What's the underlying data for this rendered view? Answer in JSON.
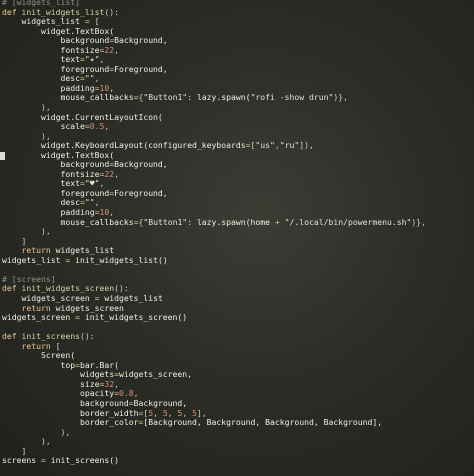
{
  "editor": {
    "cursor_line": 16,
    "lines": [
      [
        {
          "t": "# [widgets_list]",
          "c": "cmt"
        }
      ],
      [
        {
          "t": "def ",
          "c": "kw"
        },
        {
          "t": "init_widgets_list",
          "c": "fn"
        },
        {
          "t": "():",
          "c": "pn"
        }
      ],
      [
        {
          "t": "    widgets_list ",
          "c": "id"
        },
        {
          "t": "= ",
          "c": "op"
        },
        {
          "t": "[",
          "c": "pn"
        }
      ],
      [
        {
          "t": "        widget.TextBox(",
          "c": "id"
        }
      ],
      [
        {
          "t": "            background",
          "c": "id"
        },
        {
          "t": "=",
          "c": "op"
        },
        {
          "t": "Background,",
          "c": "id"
        }
      ],
      [
        {
          "t": "            fontsize",
          "c": "id"
        },
        {
          "t": "=",
          "c": "op"
        },
        {
          "t": "22",
          "c": "num"
        },
        {
          "t": ",",
          "c": "pn"
        }
      ],
      [
        {
          "t": "            text",
          "c": "id"
        },
        {
          "t": "=",
          "c": "op"
        },
        {
          "t": "\"✦\"",
          "c": "str"
        },
        {
          "t": ",",
          "c": "pn"
        }
      ],
      [
        {
          "t": "            foreground",
          "c": "id"
        },
        {
          "t": "=",
          "c": "op"
        },
        {
          "t": "Foreground,",
          "c": "id"
        }
      ],
      [
        {
          "t": "            desc",
          "c": "id"
        },
        {
          "t": "=",
          "c": "op"
        },
        {
          "t": "\"\"",
          "c": "str"
        },
        {
          "t": ",",
          "c": "pn"
        }
      ],
      [
        {
          "t": "            padding",
          "c": "id"
        },
        {
          "t": "=",
          "c": "op"
        },
        {
          "t": "10",
          "c": "num"
        },
        {
          "t": ",",
          "c": "pn"
        }
      ],
      [
        {
          "t": "            mouse_callbacks",
          "c": "id"
        },
        {
          "t": "=",
          "c": "op"
        },
        {
          "t": "{",
          "c": "pn"
        },
        {
          "t": "\"Button1\"",
          "c": "str"
        },
        {
          "t": ": ",
          "c": "pn"
        },
        {
          "t": "lazy",
          "c": "id"
        },
        {
          "t": ".spawn(",
          "c": "id"
        },
        {
          "t": "\"rofi -show drun\"",
          "c": "str"
        },
        {
          "t": ")},",
          "c": "pn"
        }
      ],
      [
        {
          "t": "        ),",
          "c": "pn"
        }
      ],
      [
        {
          "t": "        widget.CurrentLayoutIcon(",
          "c": "id"
        }
      ],
      [
        {
          "t": "            scale",
          "c": "id"
        },
        {
          "t": "=",
          "c": "op"
        },
        {
          "t": "0.5",
          "c": "num"
        },
        {
          "t": ",",
          "c": "pn"
        }
      ],
      [
        {
          "t": "        ),",
          "c": "pn"
        }
      ],
      [
        {
          "t": "        widget.KeyboardLayout(configured_keyboards",
          "c": "id"
        },
        {
          "t": "=",
          "c": "op"
        },
        {
          "t": "[",
          "c": "pn"
        },
        {
          "t": "\"us\"",
          "c": "str"
        },
        {
          "t": ",",
          "c": "pn"
        },
        {
          "t": "\"ru\"",
          "c": "str"
        },
        {
          "t": "]),",
          "c": "pn"
        }
      ],
      [
        {
          "t": "        widget.TextBox(",
          "c": "id"
        }
      ],
      [
        {
          "t": "            background",
          "c": "id"
        },
        {
          "t": "=",
          "c": "op"
        },
        {
          "t": "Background,",
          "c": "id"
        }
      ],
      [
        {
          "t": "            fontsize",
          "c": "id"
        },
        {
          "t": "=",
          "c": "op"
        },
        {
          "t": "22",
          "c": "num"
        },
        {
          "t": ",",
          "c": "pn"
        }
      ],
      [
        {
          "t": "            text",
          "c": "id"
        },
        {
          "t": "=",
          "c": "op"
        },
        {
          "t": "\"♥\"",
          "c": "str"
        },
        {
          "t": ",",
          "c": "pn"
        }
      ],
      [
        {
          "t": "            foreground",
          "c": "id"
        },
        {
          "t": "=",
          "c": "op"
        },
        {
          "t": "Foreground,",
          "c": "id"
        }
      ],
      [
        {
          "t": "            desc",
          "c": "id"
        },
        {
          "t": "=",
          "c": "op"
        },
        {
          "t": "\"\"",
          "c": "str"
        },
        {
          "t": ",",
          "c": "pn"
        }
      ],
      [
        {
          "t": "            padding",
          "c": "id"
        },
        {
          "t": "=",
          "c": "op"
        },
        {
          "t": "10",
          "c": "num"
        },
        {
          "t": ",",
          "c": "pn"
        }
      ],
      [
        {
          "t": "            mouse_callbacks",
          "c": "id"
        },
        {
          "t": "=",
          "c": "op"
        },
        {
          "t": "{",
          "c": "pn"
        },
        {
          "t": "\"Button1\"",
          "c": "str"
        },
        {
          "t": ": ",
          "c": "pn"
        },
        {
          "t": "lazy",
          "c": "id"
        },
        {
          "t": ".spawn(home ",
          "c": "id"
        },
        {
          "t": "+ ",
          "c": "op"
        },
        {
          "t": "\"/.local/bin/powermenu.sh\"",
          "c": "str"
        },
        {
          "t": ")},",
          "c": "pn"
        }
      ],
      [
        {
          "t": "        ),",
          "c": "pn"
        }
      ],
      [
        {
          "t": "    ]",
          "c": "pn"
        }
      ],
      [
        {
          "t": "    return ",
          "c": "kw"
        },
        {
          "t": "widgets_list",
          "c": "id"
        }
      ],
      [
        {
          "t": "widgets_list ",
          "c": "id"
        },
        {
          "t": "= ",
          "c": "op"
        },
        {
          "t": "init_widgets_list()",
          "c": "id"
        }
      ],
      [
        {
          "t": "",
          "c": "id"
        }
      ],
      [
        {
          "t": "# [screens]",
          "c": "cmt"
        }
      ],
      [
        {
          "t": "def ",
          "c": "kw"
        },
        {
          "t": "init_widgets_screen",
          "c": "fn"
        },
        {
          "t": "():",
          "c": "pn"
        }
      ],
      [
        {
          "t": "    widgets_screen ",
          "c": "id"
        },
        {
          "t": "= ",
          "c": "op"
        },
        {
          "t": "widgets_list",
          "c": "id"
        }
      ],
      [
        {
          "t": "    return ",
          "c": "kw"
        },
        {
          "t": "widgets_screen",
          "c": "id"
        }
      ],
      [
        {
          "t": "widgets_screen ",
          "c": "id"
        },
        {
          "t": "= ",
          "c": "op"
        },
        {
          "t": "init_widgets_screen()",
          "c": "id"
        }
      ],
      [
        {
          "t": "",
          "c": "id"
        }
      ],
      [
        {
          "t": "def ",
          "c": "kw"
        },
        {
          "t": "init_screens",
          "c": "fn"
        },
        {
          "t": "():",
          "c": "pn"
        }
      ],
      [
        {
          "t": "    return ",
          "c": "kw"
        },
        {
          "t": "[",
          "c": "pn"
        }
      ],
      [
        {
          "t": "        Screen(",
          "c": "id"
        }
      ],
      [
        {
          "t": "            top",
          "c": "id"
        },
        {
          "t": "=",
          "c": "op"
        },
        {
          "t": "bar.Bar(",
          "c": "id"
        }
      ],
      [
        {
          "t": "                widgets",
          "c": "id"
        },
        {
          "t": "=",
          "c": "op"
        },
        {
          "t": "widgets_screen,",
          "c": "id"
        }
      ],
      [
        {
          "t": "                size",
          "c": "id"
        },
        {
          "t": "=",
          "c": "op"
        },
        {
          "t": "32",
          "c": "num"
        },
        {
          "t": ",",
          "c": "pn"
        }
      ],
      [
        {
          "t": "                opacity",
          "c": "id"
        },
        {
          "t": "=",
          "c": "op"
        },
        {
          "t": "0.8",
          "c": "num"
        },
        {
          "t": ",",
          "c": "pn"
        }
      ],
      [
        {
          "t": "                background",
          "c": "id"
        },
        {
          "t": "=",
          "c": "op"
        },
        {
          "t": "Background,",
          "c": "id"
        }
      ],
      [
        {
          "t": "                border_width",
          "c": "id"
        },
        {
          "t": "=",
          "c": "op"
        },
        {
          "t": "[",
          "c": "pn"
        },
        {
          "t": "5",
          "c": "num"
        },
        {
          "t": ", ",
          "c": "pn"
        },
        {
          "t": "5",
          "c": "num"
        },
        {
          "t": ", ",
          "c": "pn"
        },
        {
          "t": "5",
          "c": "num"
        },
        {
          "t": ", ",
          "c": "pn"
        },
        {
          "t": "5",
          "c": "num"
        },
        {
          "t": "],",
          "c": "pn"
        }
      ],
      [
        {
          "t": "                border_color",
          "c": "id"
        },
        {
          "t": "=",
          "c": "op"
        },
        {
          "t": "[Background, Background, Background, Background],",
          "c": "id"
        }
      ],
      [
        {
          "t": "            ),",
          "c": "pn"
        }
      ],
      [
        {
          "t": "        ),",
          "c": "pn"
        }
      ],
      [
        {
          "t": "    ]",
          "c": "pn"
        }
      ],
      [
        {
          "t": "screens ",
          "c": "id"
        },
        {
          "t": "= ",
          "c": "op"
        },
        {
          "t": "init_screens()",
          "c": "id"
        }
      ]
    ]
  }
}
